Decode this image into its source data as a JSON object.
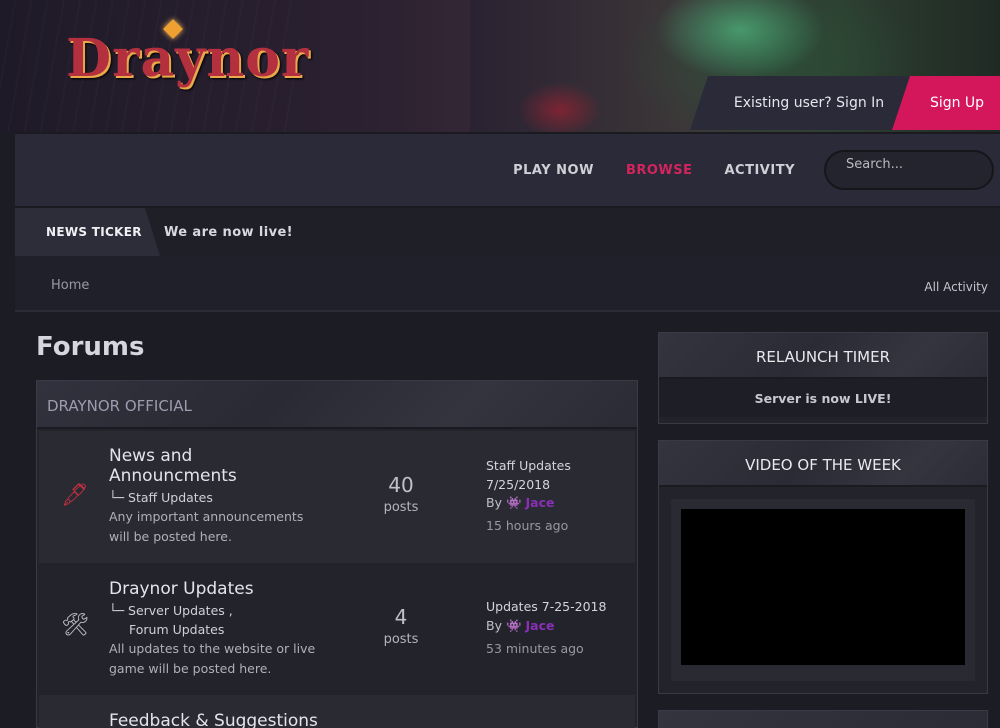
{
  "header": {
    "logo_text": "Draynor",
    "sign_in": "Existing user? Sign In",
    "sign_up": "Sign Up"
  },
  "nav": {
    "items": [
      {
        "label": "PLAY NOW",
        "active": false
      },
      {
        "label": "BROWSE",
        "active": true
      },
      {
        "label": "ACTIVITY",
        "active": false
      }
    ],
    "search_placeholder": "Search..."
  },
  "ticker": {
    "label": "NEWS TICKER",
    "text": "We are now live!"
  },
  "breadcrumb": {
    "home": "Home",
    "all_activity": "All Activity"
  },
  "page": {
    "title": "Forums"
  },
  "category": {
    "title": "DRAYNOR OFFICIAL",
    "forums": [
      {
        "title": "News and Announcments",
        "icon": "quill-icon",
        "subforums": "└─ Staff Updates",
        "description": "Any important announcements will be posted here.",
        "count": "40",
        "count_label": "posts",
        "last_title": "Staff Updates 7/25/2018",
        "by": "By",
        "user": "Jace",
        "time": "15 hours ago"
      },
      {
        "title": "Draynor Updates",
        "icon": "tools-icon",
        "subforums_1": "└─ Server Updates ,",
        "subforums_2": "Forum Updates",
        "description": "All updates to the website or live game will be posted here.",
        "count": "4",
        "count_label": "posts",
        "last_title": "Updates 7-25-2018",
        "by": "By",
        "user": "Jace",
        "time": "53 minutes ago"
      },
      {
        "title": "Feedback & Suggestions"
      }
    ]
  },
  "sidebar": {
    "relaunch": {
      "title": "RELAUNCH TIMER",
      "text": "Server is now LIVE!"
    },
    "video": {
      "title": "VIDEO OF THE WEEK"
    }
  },
  "colors": {
    "accent": "#d4165a",
    "username": "#8a2fb6"
  }
}
